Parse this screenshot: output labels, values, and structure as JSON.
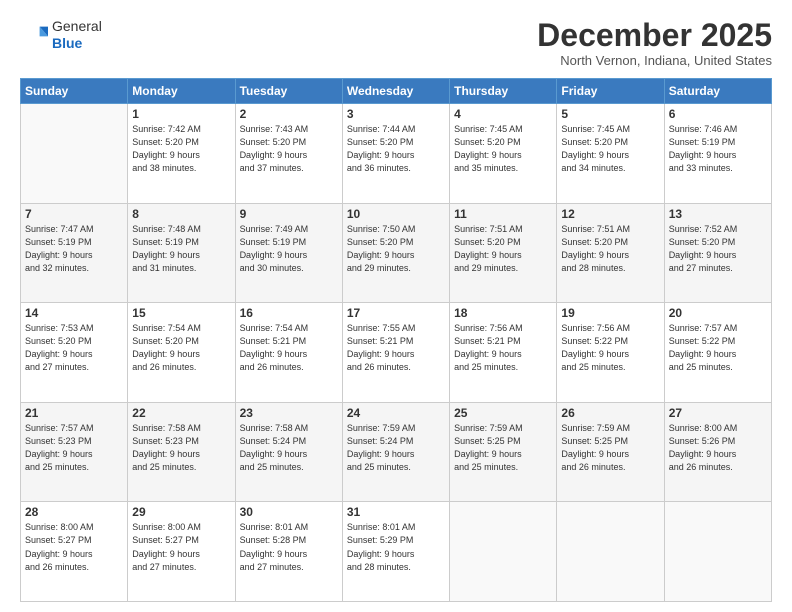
{
  "header": {
    "logo_general": "General",
    "logo_blue": "Blue",
    "month": "December 2025",
    "location": "North Vernon, Indiana, United States"
  },
  "weekdays": [
    "Sunday",
    "Monday",
    "Tuesday",
    "Wednesday",
    "Thursday",
    "Friday",
    "Saturday"
  ],
  "weeks": [
    [
      {
        "day": "",
        "info": ""
      },
      {
        "day": "1",
        "info": "Sunrise: 7:42 AM\nSunset: 5:20 PM\nDaylight: 9 hours\nand 38 minutes."
      },
      {
        "day": "2",
        "info": "Sunrise: 7:43 AM\nSunset: 5:20 PM\nDaylight: 9 hours\nand 37 minutes."
      },
      {
        "day": "3",
        "info": "Sunrise: 7:44 AM\nSunset: 5:20 PM\nDaylight: 9 hours\nand 36 minutes."
      },
      {
        "day": "4",
        "info": "Sunrise: 7:45 AM\nSunset: 5:20 PM\nDaylight: 9 hours\nand 35 minutes."
      },
      {
        "day": "5",
        "info": "Sunrise: 7:45 AM\nSunset: 5:20 PM\nDaylight: 9 hours\nand 34 minutes."
      },
      {
        "day": "6",
        "info": "Sunrise: 7:46 AM\nSunset: 5:19 PM\nDaylight: 9 hours\nand 33 minutes."
      }
    ],
    [
      {
        "day": "7",
        "info": "Sunrise: 7:47 AM\nSunset: 5:19 PM\nDaylight: 9 hours\nand 32 minutes."
      },
      {
        "day": "8",
        "info": "Sunrise: 7:48 AM\nSunset: 5:19 PM\nDaylight: 9 hours\nand 31 minutes."
      },
      {
        "day": "9",
        "info": "Sunrise: 7:49 AM\nSunset: 5:19 PM\nDaylight: 9 hours\nand 30 minutes."
      },
      {
        "day": "10",
        "info": "Sunrise: 7:50 AM\nSunset: 5:20 PM\nDaylight: 9 hours\nand 29 minutes."
      },
      {
        "day": "11",
        "info": "Sunrise: 7:51 AM\nSunset: 5:20 PM\nDaylight: 9 hours\nand 29 minutes."
      },
      {
        "day": "12",
        "info": "Sunrise: 7:51 AM\nSunset: 5:20 PM\nDaylight: 9 hours\nand 28 minutes."
      },
      {
        "day": "13",
        "info": "Sunrise: 7:52 AM\nSunset: 5:20 PM\nDaylight: 9 hours\nand 27 minutes."
      }
    ],
    [
      {
        "day": "14",
        "info": "Sunrise: 7:53 AM\nSunset: 5:20 PM\nDaylight: 9 hours\nand 27 minutes."
      },
      {
        "day": "15",
        "info": "Sunrise: 7:54 AM\nSunset: 5:20 PM\nDaylight: 9 hours\nand 26 minutes."
      },
      {
        "day": "16",
        "info": "Sunrise: 7:54 AM\nSunset: 5:21 PM\nDaylight: 9 hours\nand 26 minutes."
      },
      {
        "day": "17",
        "info": "Sunrise: 7:55 AM\nSunset: 5:21 PM\nDaylight: 9 hours\nand 26 minutes."
      },
      {
        "day": "18",
        "info": "Sunrise: 7:56 AM\nSunset: 5:21 PM\nDaylight: 9 hours\nand 25 minutes."
      },
      {
        "day": "19",
        "info": "Sunrise: 7:56 AM\nSunset: 5:22 PM\nDaylight: 9 hours\nand 25 minutes."
      },
      {
        "day": "20",
        "info": "Sunrise: 7:57 AM\nSunset: 5:22 PM\nDaylight: 9 hours\nand 25 minutes."
      }
    ],
    [
      {
        "day": "21",
        "info": "Sunrise: 7:57 AM\nSunset: 5:23 PM\nDaylight: 9 hours\nand 25 minutes."
      },
      {
        "day": "22",
        "info": "Sunrise: 7:58 AM\nSunset: 5:23 PM\nDaylight: 9 hours\nand 25 minutes."
      },
      {
        "day": "23",
        "info": "Sunrise: 7:58 AM\nSunset: 5:24 PM\nDaylight: 9 hours\nand 25 minutes."
      },
      {
        "day": "24",
        "info": "Sunrise: 7:59 AM\nSunset: 5:24 PM\nDaylight: 9 hours\nand 25 minutes."
      },
      {
        "day": "25",
        "info": "Sunrise: 7:59 AM\nSunset: 5:25 PM\nDaylight: 9 hours\nand 25 minutes."
      },
      {
        "day": "26",
        "info": "Sunrise: 7:59 AM\nSunset: 5:25 PM\nDaylight: 9 hours\nand 26 minutes."
      },
      {
        "day": "27",
        "info": "Sunrise: 8:00 AM\nSunset: 5:26 PM\nDaylight: 9 hours\nand 26 minutes."
      }
    ],
    [
      {
        "day": "28",
        "info": "Sunrise: 8:00 AM\nSunset: 5:27 PM\nDaylight: 9 hours\nand 26 minutes."
      },
      {
        "day": "29",
        "info": "Sunrise: 8:00 AM\nSunset: 5:27 PM\nDaylight: 9 hours\nand 27 minutes."
      },
      {
        "day": "30",
        "info": "Sunrise: 8:01 AM\nSunset: 5:28 PM\nDaylight: 9 hours\nand 27 minutes."
      },
      {
        "day": "31",
        "info": "Sunrise: 8:01 AM\nSunset: 5:29 PM\nDaylight: 9 hours\nand 28 minutes."
      },
      {
        "day": "",
        "info": ""
      },
      {
        "day": "",
        "info": ""
      },
      {
        "day": "",
        "info": ""
      }
    ]
  ]
}
